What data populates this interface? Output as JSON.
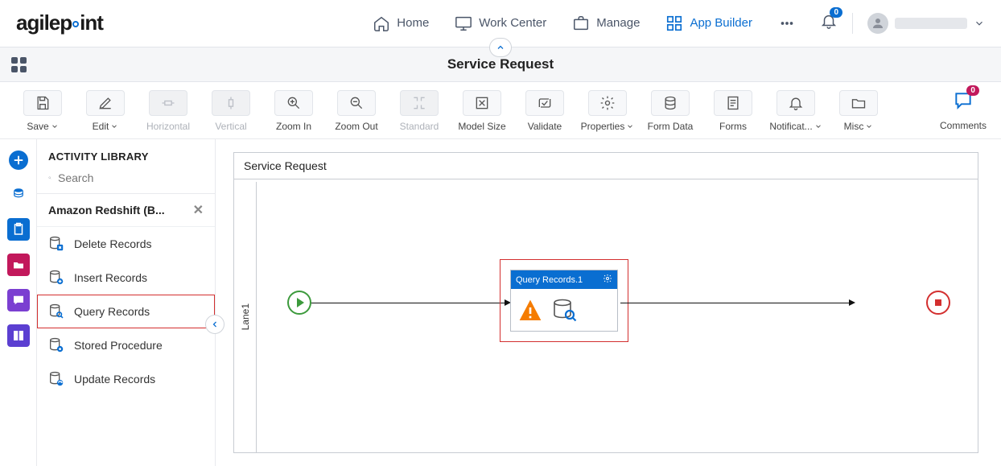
{
  "brand": "agilepoint",
  "nav": {
    "home": "Home",
    "work_center": "Work Center",
    "manage": "Manage",
    "app_builder": "App Builder"
  },
  "notifications_count": "0",
  "page_title": "Service Request",
  "toolbar": {
    "save": "Save",
    "edit": "Edit",
    "horizontal": "Horizontal",
    "vertical": "Vertical",
    "zoom_in": "Zoom In",
    "zoom_out": "Zoom Out",
    "standard": "Standard",
    "model_size": "Model Size",
    "validate": "Validate",
    "properties": "Properties",
    "form_data": "Form Data",
    "forms": "Forms",
    "notifications": "Notificat...",
    "misc": "Misc",
    "comments": "Comments",
    "comments_count": "0"
  },
  "library": {
    "header": "ACTIVITY LIBRARY",
    "search_placeholder": "Search",
    "category": "Amazon Redshift (B...",
    "items": {
      "delete": "Delete Records",
      "insert": "Insert Records",
      "query": "Query Records",
      "stored": "Stored Procedure",
      "update": "Update Records"
    }
  },
  "process": {
    "title": "Service Request",
    "lane": "Lane1",
    "activity_name": "Query Records.1"
  }
}
